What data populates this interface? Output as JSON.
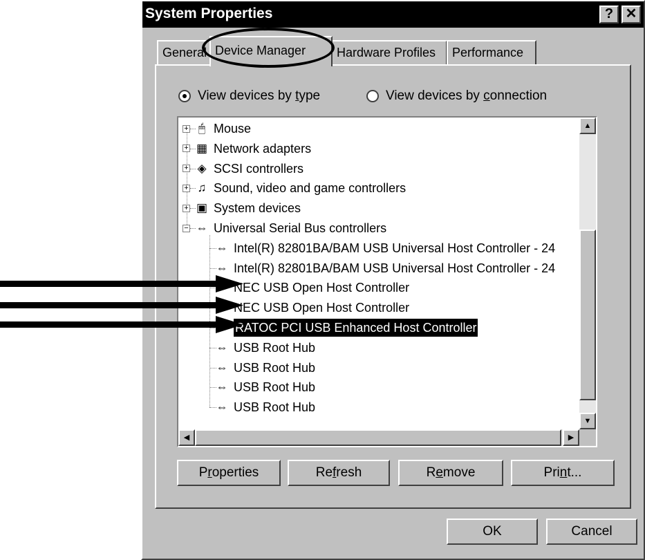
{
  "window": {
    "title": "System Properties",
    "help_glyph": "?",
    "close_glyph": "✕"
  },
  "tabs": [
    {
      "label": "General",
      "active": false
    },
    {
      "label": "Device Manager",
      "active": true
    },
    {
      "label": "Hardware Profiles",
      "active": false
    },
    {
      "label": "Performance",
      "active": false
    }
  ],
  "view": {
    "by_type": {
      "pre": "View devices by ",
      "underline": "t",
      "post": "ype",
      "selected": true
    },
    "by_connection": {
      "pre": "View devices by ",
      "underline": "c",
      "post": "onnection",
      "selected": false
    }
  },
  "tree": [
    {
      "label": "Mouse",
      "icon": "mouse-icon",
      "expander": "+"
    },
    {
      "label": "Network adapters",
      "icon": "network-icon",
      "expander": "+"
    },
    {
      "label": "SCSI controllers",
      "icon": "scsi-icon",
      "expander": "+"
    },
    {
      "label": "Sound, video and game controllers",
      "icon": "sound-icon",
      "expander": "+"
    },
    {
      "label": "System devices",
      "icon": "computer-icon",
      "expander": "+"
    },
    {
      "label": "Universal Serial Bus controllers",
      "icon": "usb-icon",
      "expander": "−"
    },
    {
      "label": "Intel(R) 82801BA/BAM USB Universal Host Controller - 24",
      "icon": "usb-icon"
    },
    {
      "label": "Intel(R) 82801BA/BAM USB Universal Host Controller - 24",
      "icon": "usb-icon"
    },
    {
      "label": "NEC USB Open Host Controller",
      "icon": "usb-icon"
    },
    {
      "label": "NEC USB Open Host Controller",
      "icon": "usb-icon"
    },
    {
      "label": "RATOC PCI USB Enhanced Host Controller",
      "icon": "usb-icon",
      "selected": true
    },
    {
      "label": "USB Root Hub",
      "icon": "usb-icon"
    },
    {
      "label": "USB Root Hub",
      "icon": "usb-icon"
    },
    {
      "label": "USB Root Hub",
      "icon": "usb-icon"
    },
    {
      "label": "USB Root Hub",
      "icon": "usb-icon"
    }
  ],
  "buttons": {
    "properties": {
      "pre": "P",
      "underline": "r",
      "post": "operties"
    },
    "refresh": {
      "pre": "Re",
      "underline": "f",
      "post": "resh"
    },
    "remove": {
      "pre": "R",
      "underline": "e",
      "post": "move"
    },
    "print": {
      "pre": "Pri",
      "underline": "n",
      "post": "t..."
    },
    "ok": "OK",
    "cancel": "Cancel"
  },
  "scroll_glyphs": {
    "up": "▲",
    "down": "▼",
    "left": "◀",
    "right": "▶"
  }
}
